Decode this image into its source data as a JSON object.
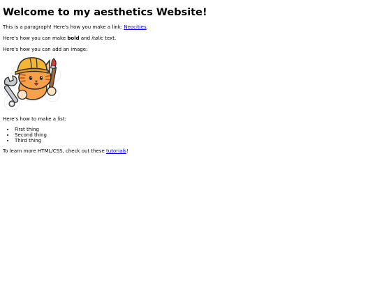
{
  "page": {
    "heading": "Welcome to my aesthetics Website!",
    "para1_prefix": "This is a paragraph! Here's how you make a link: ",
    "para1_link": "Neocities",
    "para1_suffix": ".",
    "para2_prefix": "Here's how you can make ",
    "para2_bold": "bold",
    "para2_mid": " and ",
    "para2_italic": "italic",
    "para2_suffix": " text.",
    "para3": "Here's how you can add an image:",
    "image": {
      "icon": "neocities-cat-mascot",
      "colors": {
        "helmet": "#f5b733",
        "fur": "#f7a24a",
        "outline": "#2b2b2b",
        "brush_tip": "#e2363b",
        "tool": "#c9ccd1"
      }
    },
    "para4": "Here's how to make a list:",
    "list": [
      "First thing",
      "Second thing",
      "Third thing"
    ],
    "para5_prefix": "To learn more HTML/CSS, check out these ",
    "para5_link": "tutorials",
    "para5_suffix": "!",
    "link_color": "#0000ee"
  }
}
